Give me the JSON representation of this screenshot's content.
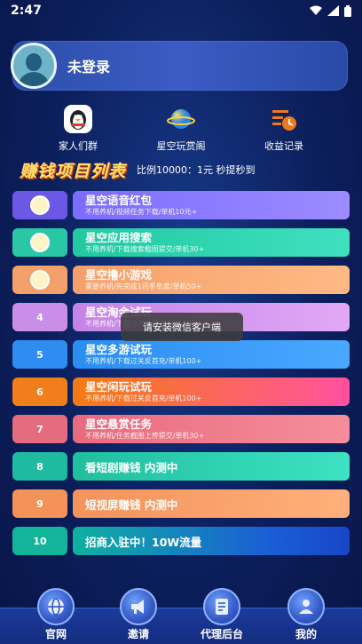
{
  "status": {
    "time": "2:47"
  },
  "profile": {
    "name": "未登录"
  },
  "quick": [
    {
      "label": "家人们群",
      "icon": "penguin-icon"
    },
    {
      "label": "星空玩赏阁",
      "icon": "planet-icon"
    },
    {
      "label": "收益记录",
      "icon": "record-clock-icon"
    }
  ],
  "section": {
    "title": "赚钱项目列表",
    "ratio": "比例10000：1元 秒提秒到"
  },
  "tasks": [
    {
      "badge": "",
      "title": "星空语音红包",
      "sub": "不用养机/视频任务下载/单机10元+",
      "color": "#6b58e6",
      "card": "linear-gradient(90deg,#7b6cff,#9d8bff)"
    },
    {
      "badge": "",
      "title": "星空应用搜索",
      "sub": "不用养机/下载搜索截图提交/单机30+",
      "color": "#2ac7a7",
      "card": "linear-gradient(90deg,#22c8a0,#3fe0c0)"
    },
    {
      "badge": "",
      "title": "星空撸小游戏",
      "sub": "需要养机/先完成1讯手阜度/单机50+",
      "color": "#f2a16b",
      "card": "linear-gradient(90deg,#f6a06a,#ffb985)"
    },
    {
      "badge": "4",
      "title": "星空淘金试玩",
      "sub": "不用养机/下载过关反首充/单机100+",
      "color": "#c98ee8",
      "card": "linear-gradient(90deg,#c484e6,#e0a8f5)"
    },
    {
      "badge": "5",
      "title": "星空多游试玩",
      "sub": "不用养机/下载过关反首充/单机100+",
      "color": "#2f8cf0",
      "card": "linear-gradient(90deg,#2a8df2,#4aa8ff)"
    },
    {
      "badge": "6",
      "title": "星空闲玩试玩",
      "sub": "不用养机/下载过关反首充/单机100+",
      "color": "#f07e1a",
      "card": "linear-gradient(90deg,#f57b10,#ff5a8a 85%,#ff4fa0)"
    },
    {
      "badge": "7",
      "title": "星空悬赏任务",
      "sub": "不用养机/任务截图上传提交/单机30+",
      "color": "#e46c7e",
      "card": "linear-gradient(90deg,#e86a7d,#f58e9a)"
    },
    {
      "badge": "8",
      "title": "看短剧赚钱 内测中",
      "sub": "",
      "color": "#1fbba0",
      "card": "linear-gradient(90deg,#1fbf9e,#3de2c2)"
    },
    {
      "badge": "9",
      "title": "短视屏赚钱 内测中",
      "sub": "",
      "color": "#f3935a",
      "card": "linear-gradient(90deg,#f4925a,#ffb07b)"
    },
    {
      "badge": "10",
      "title": "招商入驻中！10W流量",
      "sub": "",
      "color": "#13b49a",
      "card": "linear-gradient(90deg,#0fb0a0,#1a5fd6 70%,#1746c8)"
    }
  ],
  "toast": "请安装微信客户端",
  "nav": [
    {
      "label": "官网",
      "icon": "globe-icon"
    },
    {
      "label": "邀请",
      "icon": "megaphone-icon"
    },
    {
      "label": "代理后台",
      "icon": "document-icon"
    },
    {
      "label": "我的",
      "icon": "user-icon"
    }
  ]
}
